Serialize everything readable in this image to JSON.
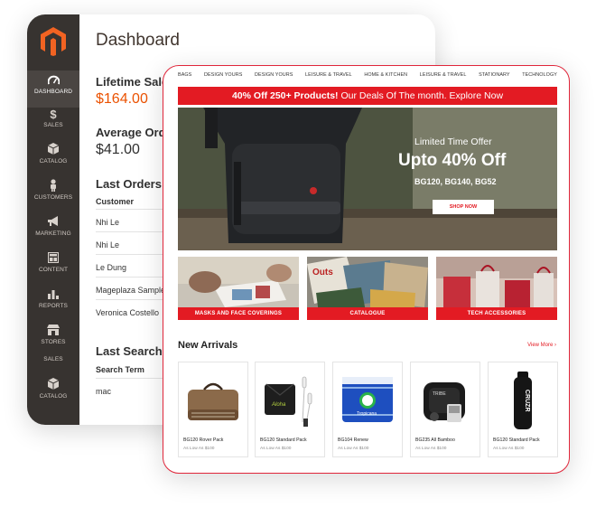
{
  "admin": {
    "title": "Dashboard",
    "sidebar": [
      {
        "label": "DASHBOARD",
        "icon": "gauge-icon"
      },
      {
        "label": "SALES",
        "icon": "dollar-icon"
      },
      {
        "label": "CATALOG",
        "icon": "cube-icon"
      },
      {
        "label": "CUSTOMERS",
        "icon": "person-icon"
      },
      {
        "label": "MARKETING",
        "icon": "megaphone-icon"
      },
      {
        "label": "CONTENT",
        "icon": "layout-icon"
      },
      {
        "label": "REPORTS",
        "icon": "bar-chart-icon"
      },
      {
        "label": "STORES",
        "icon": "storefront-icon"
      },
      {
        "label": "SALES",
        "icon": "none"
      },
      {
        "label": "CATALOG",
        "icon": "cube-icon"
      }
    ],
    "lifetime_sales_label": "Lifetime Sale",
    "lifetime_sales_value": "$164.00",
    "average_order_label": "Average Orde",
    "average_order_value": "$41.00",
    "last_orders_title": "Last Orders",
    "customer_header": "Customer",
    "customers": [
      "Nhi Le",
      "Nhi Le",
      "Le Dung",
      "Mageplaza Sample",
      "Veronica Costello"
    ],
    "last_search_title": "Last Search T",
    "search_term_header": "Search Term",
    "search_terms": [
      "mac"
    ]
  },
  "store": {
    "nav": [
      "BAGS",
      "DESIGN YOURS",
      "DESIGN YOURS",
      "LEISURE & TRAVEL",
      "HOME & KITCHEN",
      "LEISURE & TRAVEL",
      "STATIONARY",
      "TECHNOLOGY"
    ],
    "promo_bold": "40% Off 250+ Products!",
    "promo_rest": " Our Deals Of The month.  Explore Now",
    "hero_sub": "Limited Time Offer",
    "hero_big": "Upto 40% Off",
    "hero_codes": "BG120, BG140, BG52",
    "shop_now": "SHOP NOW",
    "categories": [
      "MASKS AND FACE COVERINGS",
      "CATALOGUE",
      "TECH ACCESSORIES"
    ],
    "new_arrivals": "New Arrivals",
    "view_more": "View More  ›",
    "products": [
      {
        "name": "BG120 Rover Pack",
        "price": "As Low As $100"
      },
      {
        "name": "BG120 Standard Pack",
        "price": "As Low As $100"
      },
      {
        "name": "BG104 Renew",
        "price": "As Low As $100"
      },
      {
        "name": "BG235 All Bamboo",
        "price": "As Low As $100"
      },
      {
        "name": "BG120 Standard Pack",
        "price": "As Low As $100"
      }
    ],
    "bottle_text": "CRUZR",
    "brand_color": "#e31b23"
  }
}
